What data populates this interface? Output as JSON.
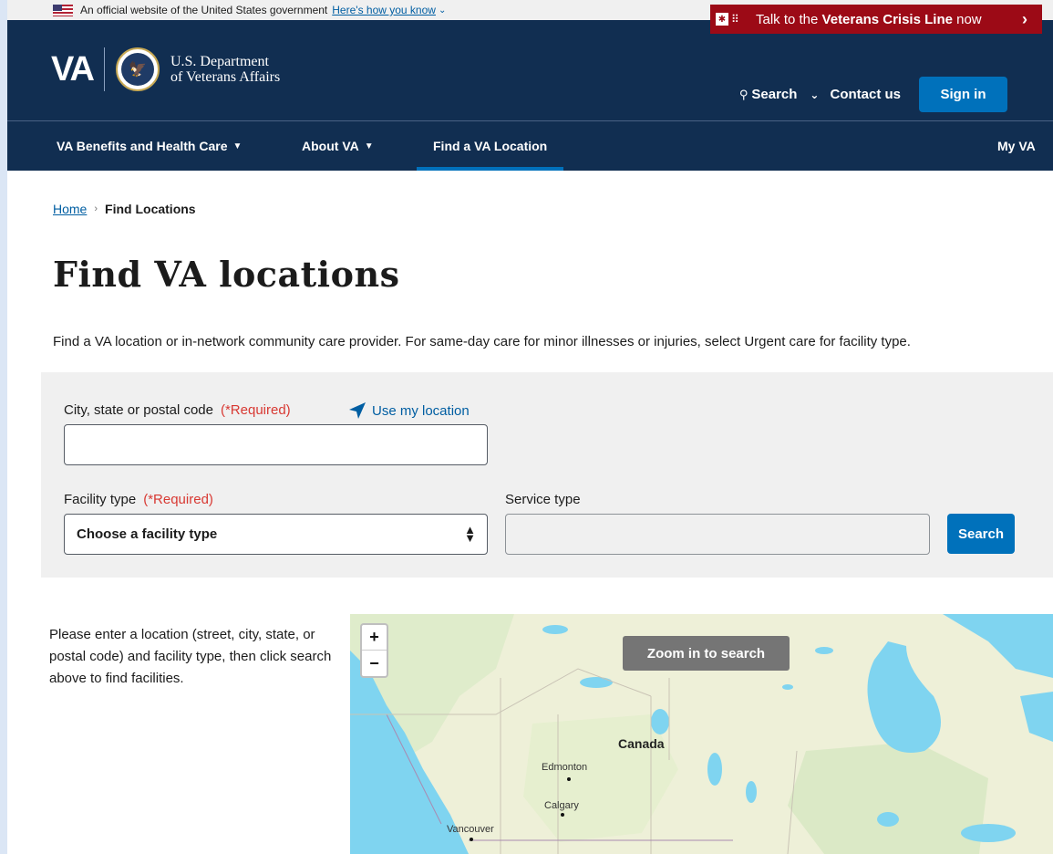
{
  "gov_banner": {
    "text": "An official website of the United States government",
    "link": "Here's how you know",
    "icon": "us-flag-icon"
  },
  "crisis": {
    "prefix": "Talk to the ",
    "bold": "Veterans Crisis Line",
    "suffix": " now",
    "icon": "crisis-line-icon"
  },
  "header": {
    "logo_text": "VA",
    "dept_line1": "U.S. Department",
    "dept_line2": "of Veterans Affairs",
    "search_label": "Search",
    "contact_label": "Contact us",
    "signin_label": "Sign in"
  },
  "nav": {
    "benefits": "VA Benefits and Health Care",
    "about": "About VA",
    "find": "Find a VA Location",
    "myva": "My VA"
  },
  "breadcrumb": {
    "home": "Home",
    "current": "Find Locations"
  },
  "main": {
    "title": "Find VA locations",
    "intro": "Find a VA location or in-network community care provider. For same-day care for minor illnesses or injuries, select Urgent care for facility type."
  },
  "form": {
    "location_label": "City, state or postal code",
    "required": "(*Required)",
    "use_location": "Use my location",
    "location_value": "",
    "facility_label": "Facility type",
    "facility_selected": "Choose a facility type",
    "service_label": "Service type",
    "service_value": "",
    "search_button": "Search"
  },
  "help_text": "Please enter a location (street, city, state, or postal code) and facility type, then click search above to find facilities.",
  "map": {
    "zoom_in": "+",
    "zoom_out": "−",
    "zoom_message": "Zoom in to search",
    "labels": {
      "canada": "Canada",
      "edmonton": "Edmonton",
      "calgary": "Calgary",
      "vancouver": "Vancouver"
    }
  }
}
